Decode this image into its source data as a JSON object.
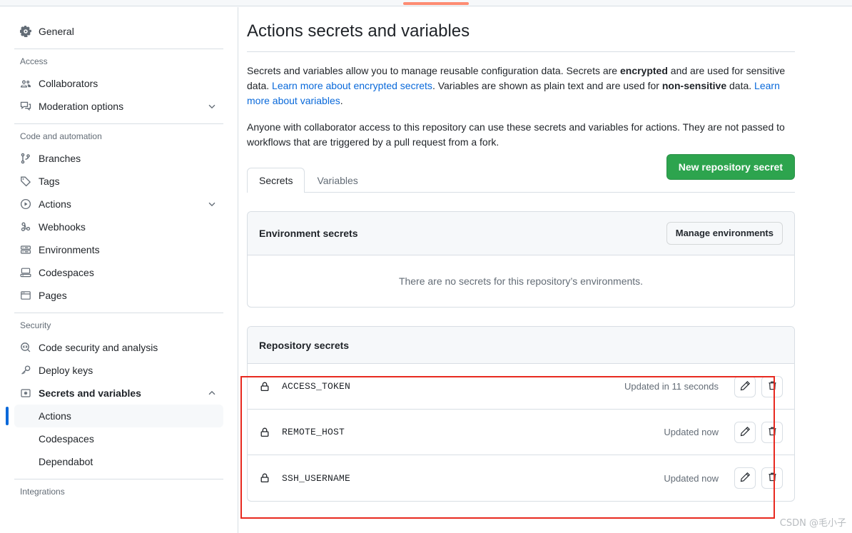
{
  "topbar": {
    "accent_color": "#fd8c73"
  },
  "sidebar": {
    "general": {
      "label": "General",
      "icon": "gear-icon"
    },
    "groups": [
      {
        "title": "Access",
        "items": [
          {
            "label": "Collaborators",
            "icon": "people-icon",
            "expandable": false
          },
          {
            "label": "Moderation options",
            "icon": "comment-discussion-icon",
            "expandable": true,
            "chevron": "chevron-down"
          }
        ]
      },
      {
        "title": "Code and automation",
        "items": [
          {
            "label": "Branches",
            "icon": "git-branch-icon",
            "expandable": false
          },
          {
            "label": "Tags",
            "icon": "tag-icon",
            "expandable": false
          },
          {
            "label": "Actions",
            "icon": "play-icon",
            "expandable": true,
            "chevron": "chevron-down"
          },
          {
            "label": "Webhooks",
            "icon": "webhook-icon",
            "expandable": false
          },
          {
            "label": "Environments",
            "icon": "server-icon",
            "expandable": false
          },
          {
            "label": "Codespaces",
            "icon": "codespaces-icon",
            "expandable": false
          },
          {
            "label": "Pages",
            "icon": "browser-icon",
            "expandable": false
          }
        ]
      },
      {
        "title": "Security",
        "items": [
          {
            "label": "Code security and analysis",
            "icon": "codescan-icon",
            "expandable": false
          },
          {
            "label": "Deploy keys",
            "icon": "key-icon",
            "expandable": false
          },
          {
            "label": "Secrets and variables",
            "icon": "asterisk-key-icon",
            "expandable": true,
            "chevron": "chevron-up"
          }
        ],
        "subitems": [
          {
            "label": "Actions",
            "active": true
          },
          {
            "label": "Codespaces",
            "active": false
          },
          {
            "label": "Dependabot",
            "active": false
          }
        ]
      },
      {
        "title": "Integrations",
        "items": []
      }
    ]
  },
  "main": {
    "title": "Actions secrets and variables",
    "paragraph1": {
      "part1": "Secrets and variables allow you to manage reusable configuration data. Secrets are ",
      "bold1": "encrypted",
      "part2": " and are used for sensitive data. ",
      "link1": "Learn more about encrypted secrets",
      "part3": ". Variables are shown as plain text and are used for ",
      "bold2": "non-sensitive",
      "part4": " data. ",
      "link2": "Learn more about variables",
      "part5": "."
    },
    "paragraph2": "Anyone with collaborator access to this repository can use these secrets and variables for actions. They are not passed to workflows that are triggered by a pull request from a fork.",
    "tabs": [
      {
        "label": "Secrets",
        "active": true
      },
      {
        "label": "Variables",
        "active": false
      }
    ],
    "new_secret_button": {
      "label": "New repository secret",
      "color": "#2da44e"
    },
    "environment_secrets": {
      "title": "Environment secrets",
      "manage_button": "Manage environments",
      "empty_text": "There are no secrets for this repository’s environments."
    },
    "repository_secrets": {
      "title": "Repository secrets",
      "rows": [
        {
          "name": "ACCESS_TOKEN",
          "updated": "Updated in 11 seconds",
          "edit_icon": "pencil-icon",
          "delete_icon": "trash-icon"
        },
        {
          "name": "REMOTE_HOST",
          "updated": "Updated now",
          "edit_icon": "pencil-icon",
          "delete_icon": "trash-icon"
        },
        {
          "name": "SSH_USERNAME",
          "updated": "Updated now",
          "edit_icon": "pencil-icon",
          "delete_icon": "trash-icon"
        }
      ]
    }
  },
  "annotation": {
    "highlight_color": "#e8291f"
  },
  "watermark": {
    "text": "CSDN @毛小子"
  }
}
